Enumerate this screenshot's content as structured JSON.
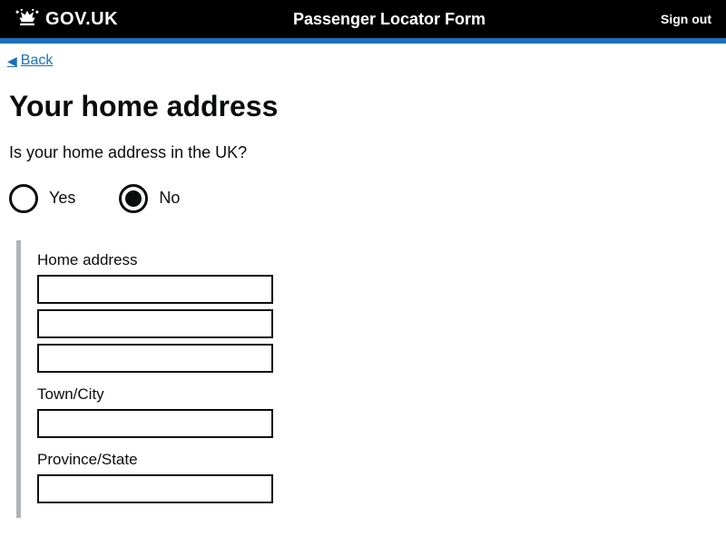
{
  "header": {
    "logo_text": "GOV.UK",
    "title": "Passenger Locator Form",
    "sign_out": "Sign out"
  },
  "back": {
    "label": "Back"
  },
  "page": {
    "title": "Your home address",
    "question": "Is your home address in the UK?"
  },
  "radios": {
    "yes_label": "Yes",
    "no_label": "No",
    "selected": "no"
  },
  "address": {
    "home_label": "Home address",
    "line1": "",
    "line2": "",
    "line3": "",
    "town_label": "Town/City",
    "town": "",
    "province_label": "Province/State",
    "province": ""
  }
}
